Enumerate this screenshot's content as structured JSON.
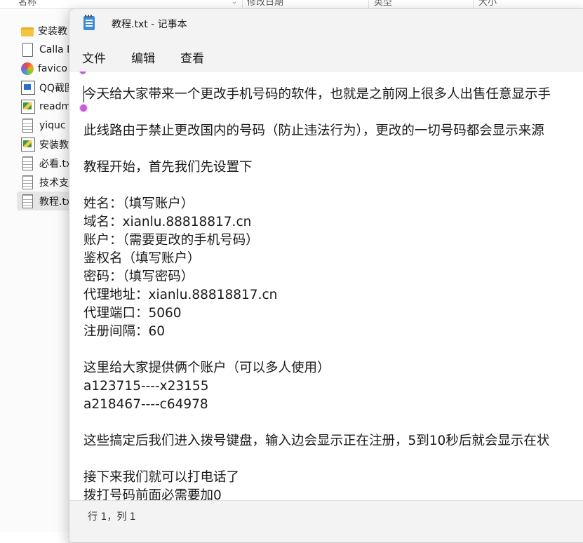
{
  "explorer": {
    "columns": [
      {
        "label": "名称"
      },
      {
        "label": "修改日期"
      },
      {
        "label": "类型"
      },
      {
        "label": "大小"
      }
    ],
    "files": [
      {
        "name": "安装教",
        "icon": "folder-icon"
      },
      {
        "name": "Calla D",
        "icon": "document-icon"
      },
      {
        "name": "favico",
        "icon": "color-wheel-icon"
      },
      {
        "name": "QQ截图",
        "icon": "image-file-icon"
      },
      {
        "name": "readm",
        "icon": "notepadpp-file-icon"
      },
      {
        "name": "yiquc",
        "icon": "text-file-icon"
      },
      {
        "name": "安装教",
        "icon": "notepadpp-file-icon"
      },
      {
        "name": "必看.tx",
        "icon": "text-file-icon"
      },
      {
        "name": "技术支",
        "icon": "text-file-icon"
      },
      {
        "name": "教程.tx",
        "icon": "text-file-icon",
        "selected": true
      }
    ]
  },
  "notepad": {
    "title": "教程.txt - 记事本",
    "menu": [
      "文件",
      "编辑",
      "查看"
    ],
    "lines": [
      "今天给大家带来一个更改手机号码的软件，也就是之前网上很多人出售任意显示手",
      "",
      "此线路由于禁止更改国内的号码（防止违法行为），更改的一切号码都会显示来源",
      "",
      "教程开始，首先我们先设置下",
      "",
      "姓名：（填写账户）",
      "域名：xianlu.88818817.cn",
      "账户：（需要更改的手机号码）",
      "鉴权名（填写账户）",
      "密码：（填写密码）",
      "代理地址：xianlu.88818817.cn",
      "代理端口：5060",
      "注册间隔：60",
      "",
      "这里给大家提供俩个账户（可以多人使用）",
      "a123715----x23155",
      "a218467----c64978",
      "",
      "这些搞定后我们进入拨号键盘，输入边会显示正在注册，5到10秒后就会显示在状",
      "",
      "接下来我们就可以打电话了",
      "拨打号码前面必需要加0"
    ],
    "status": "行 1，列 1"
  }
}
